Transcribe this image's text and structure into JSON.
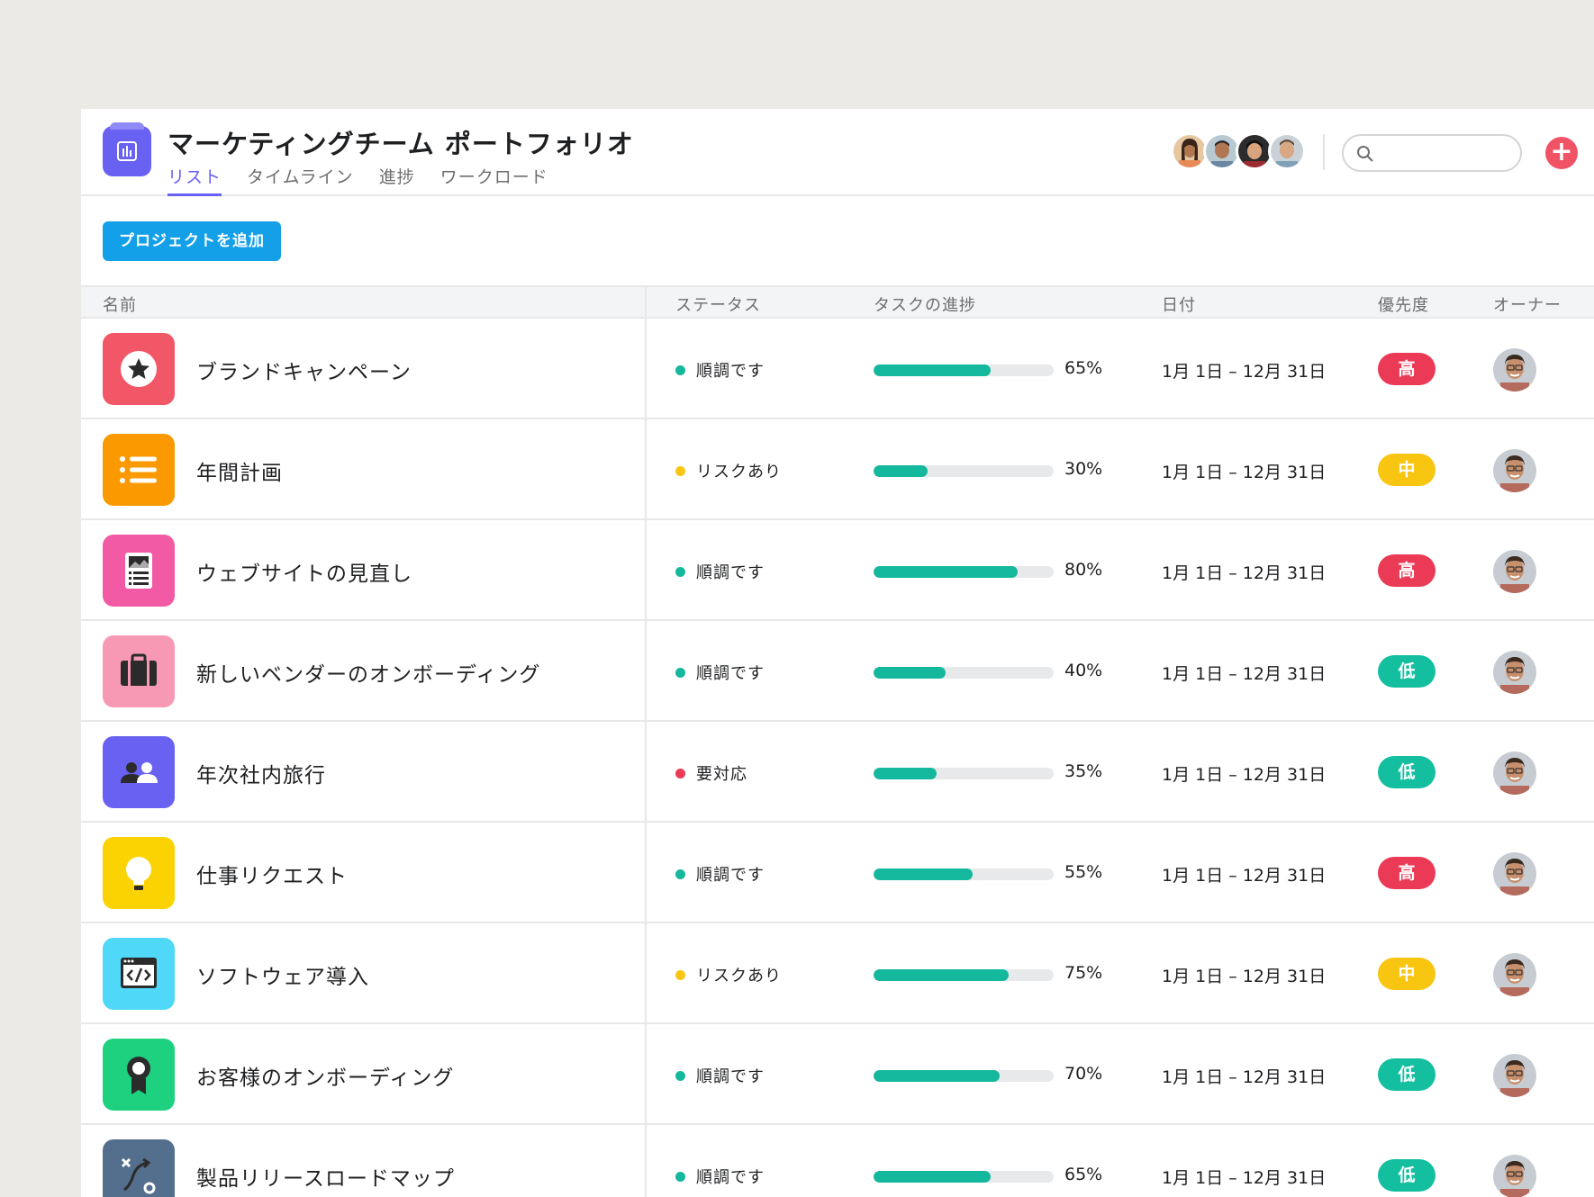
{
  "header": {
    "title": "マーケティングチーム ポートフォリオ",
    "tabs": [
      {
        "label": "リスト",
        "active": true
      },
      {
        "label": "タイムライン",
        "active": false
      },
      {
        "label": "進捗",
        "active": false
      },
      {
        "label": "ワークロード",
        "active": false
      }
    ],
    "search": {
      "placeholder": "",
      "value": ""
    },
    "add_icon": "plus-icon"
  },
  "toolbar": {
    "add_project_label": "プロジェクトを追加"
  },
  "table": {
    "columns": {
      "name": "名前",
      "status": "ステータス",
      "progress": "タスクの進捗",
      "date": "日付",
      "priority": "優先度",
      "owner": "オーナー"
    },
    "rows": [
      {
        "name": "ブランドキャンペーン",
        "icon": "star-icon",
        "icon_color": "#f25767",
        "status": "順調です",
        "status_color": "#14b89c",
        "progress": 65,
        "progress_label": "65%",
        "date": "1月 1日 – 12月 31日",
        "priority": "高",
        "priority_color": "#eb3a55"
      },
      {
        "name": "年間計画",
        "icon": "list-icon",
        "icon_color": "#fa9a00",
        "status": "リスクあり",
        "status_color": "#f8c511",
        "progress": 30,
        "progress_label": "30%",
        "date": "1月 1日 – 12月 31日",
        "priority": "中",
        "priority_color": "#f8c511"
      },
      {
        "name": "ウェブサイトの見直し",
        "icon": "document-icon",
        "icon_color": "#f25aa6",
        "status": "順調です",
        "status_color": "#14b89c",
        "progress": 80,
        "progress_label": "80%",
        "date": "1月 1日 – 12月 31日",
        "priority": "高",
        "priority_color": "#eb3a55"
      },
      {
        "name": "新しいベンダーのオンボーディング",
        "icon": "briefcase-icon",
        "icon_color": "#f799b4",
        "status": "順調です",
        "status_color": "#14b89c",
        "progress": 40,
        "progress_label": "40%",
        "date": "1月 1日 – 12月 31日",
        "priority": "低",
        "priority_color": "#14bfa0"
      },
      {
        "name": "年次社内旅行",
        "icon": "people-icon",
        "icon_color": "#6861f2",
        "status": "要対応",
        "status_color": "#eb3a55",
        "progress": 35,
        "progress_label": "35%",
        "date": "1月 1日 – 12月 31日",
        "priority": "低",
        "priority_color": "#14bfa0"
      },
      {
        "name": "仕事リクエスト",
        "icon": "lightbulb-icon",
        "icon_color": "#fcd302",
        "status": "順調です",
        "status_color": "#14b89c",
        "progress": 55,
        "progress_label": "55%",
        "date": "1月 1日 – 12月 31日",
        "priority": "高",
        "priority_color": "#eb3a55"
      },
      {
        "name": "ソフトウェア導入",
        "icon": "code-icon",
        "icon_color": "#4fd8f7",
        "status": "リスクあり",
        "status_color": "#f8c511",
        "progress": 75,
        "progress_label": "75%",
        "date": "1月 1日 – 12月 31日",
        "priority": "中",
        "priority_color": "#f8c511"
      },
      {
        "name": "お客様のオンボーディング",
        "icon": "award-icon",
        "icon_color": "#1ed17f",
        "status": "順調です",
        "status_color": "#14b89c",
        "progress": 70,
        "progress_label": "70%",
        "date": "1月 1日 – 12月 31日",
        "priority": "低",
        "priority_color": "#14bfa0"
      },
      {
        "name": "製品リリースロードマップ",
        "icon": "route-icon",
        "icon_color": "#546e8d",
        "status": "順調です",
        "status_color": "#14b89c",
        "progress": 65,
        "progress_label": "65%",
        "date": "1月 1日 – 12月 31日",
        "priority": "低",
        "priority_color": "#14bfa0"
      }
    ]
  },
  "colors": {
    "accent": "#6861f2",
    "button_blue": "#14a0e8",
    "progress": "#14b89c"
  }
}
